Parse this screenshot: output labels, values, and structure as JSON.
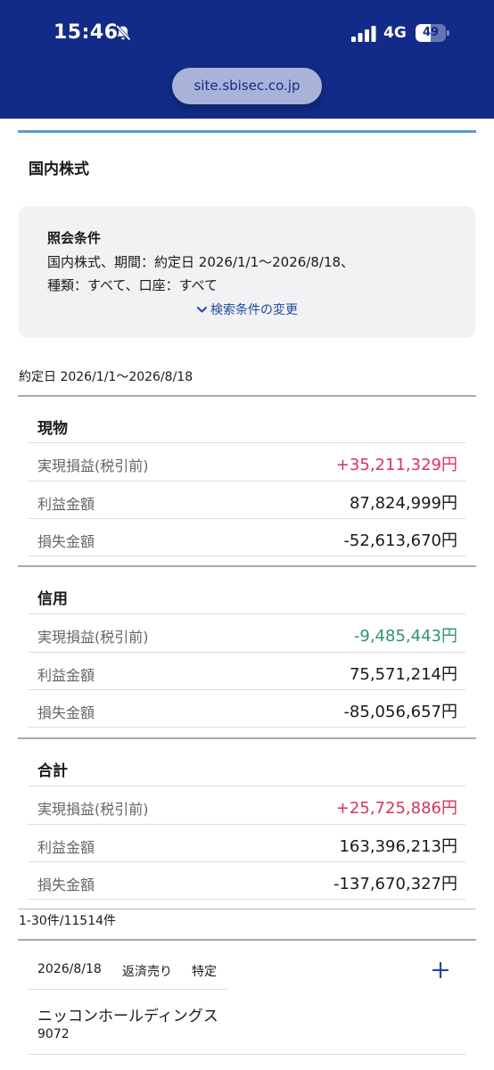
{
  "status": {
    "time": "15:46",
    "network": "4G",
    "battery": "49",
    "battery_level": 0.49
  },
  "browser": {
    "url": "site.sbisec.co.jp"
  },
  "page": {
    "title": "国内株式"
  },
  "conditions": {
    "heading": "照会条件",
    "line1": "国内株式、期間：約定日 2026/1/1〜2026/8/18、",
    "line2": "種類：すべて、口座：すべて",
    "change_label": "検索条件の変更"
  },
  "period_label": "約定日 2026/1/1〜2026/8/18",
  "groups": [
    {
      "title": "現物",
      "rows": [
        {
          "label": "実現損益(税引前)",
          "value": "+35,211,329円",
          "tone": "pos"
        },
        {
          "label": "利益金額",
          "value": "87,824,999円",
          "tone": "plain"
        },
        {
          "label": "損失金額",
          "value": "-52,613,670円",
          "tone": "plain"
        }
      ]
    },
    {
      "title": "信用",
      "rows": [
        {
          "label": "実現損益(税引前)",
          "value": "-9,485,443円",
          "tone": "neg"
        },
        {
          "label": "利益金額",
          "value": "75,571,214円",
          "tone": "plain"
        },
        {
          "label": "損失金額",
          "value": "-85,056,657円",
          "tone": "plain"
        }
      ]
    },
    {
      "title": "合計",
      "rows": [
        {
          "label": "実現損益(税引前)",
          "value": "+25,725,886円",
          "tone": "pos"
        },
        {
          "label": "利益金額",
          "value": "163,396,213円",
          "tone": "plain"
        },
        {
          "label": "損失金額",
          "value": "-137,670,327円",
          "tone": "plain"
        }
      ]
    }
  ],
  "count_label": "1-30件/11514件",
  "list_item": {
    "date": "2026/8/18",
    "trade_type": "返済売り",
    "account": "特定",
    "name": "ニッコンホールディングス",
    "code": "9072"
  },
  "colors": {
    "header_bg": "#132b88",
    "profit": "#d6335a",
    "loss": "#2f9178",
    "link": "#1d4a9c"
  },
  "icons": [
    "bell-slash-icon",
    "signal-icon",
    "battery-icon",
    "chevron-down-icon",
    "plus-icon"
  ]
}
